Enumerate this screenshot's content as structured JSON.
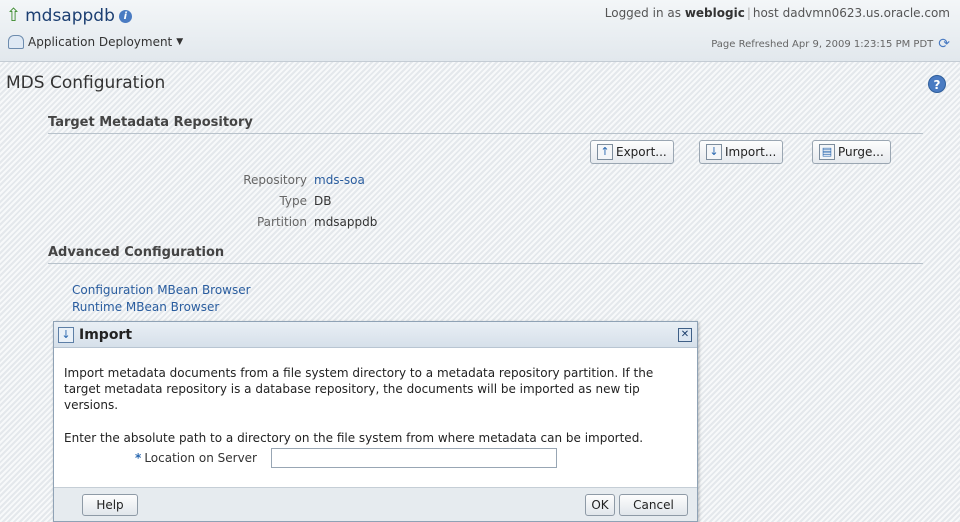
{
  "header": {
    "app_title": "mdsappdb",
    "app_menu": "Application Deployment",
    "login_prefix": "Logged in as",
    "user": "weblogic",
    "host_label": "host",
    "host": "dadvmn0623.us.oracle.com",
    "refreshed": "Page Refreshed Apr 9, 2009 1:23:15 PM PDT"
  },
  "page": {
    "title": "MDS Configuration",
    "help_icon": "?"
  },
  "target_section": {
    "heading": "Target Metadata Repository",
    "buttons": {
      "export": "Export...",
      "import": "Import...",
      "purge": "Purge..."
    },
    "properties": [
      {
        "label": "Repository",
        "value": "mds-soa"
      },
      {
        "label": "Type",
        "value": "DB"
      },
      {
        "label": "Partition",
        "value": "mdsappdb"
      }
    ]
  },
  "advanced_section": {
    "heading": "Advanced Configuration",
    "links": [
      "Configuration MBean Browser",
      "Runtime MBean Browser"
    ]
  },
  "dialog": {
    "title": "Import",
    "description": "Import metadata documents from a file system directory to a metadata repository partition. If the target metadata repository is a database repository, the documents will be imported as new tip versions.",
    "instruction": "Enter the absolute path to a directory on the file system from where metadata can be imported.",
    "location_label": "Location on Server",
    "location_value": "",
    "help_label": "Help",
    "ok_label": "OK",
    "cancel_label": "Cancel"
  },
  "icons": {
    "up": "up-arrow-icon",
    "info": "info-icon",
    "refresh": "refresh-icon",
    "help": "help-icon",
    "close": "close-icon"
  },
  "colors": {
    "link": "#2a5d9f",
    "title": "#1c3f72",
    "accent": "#4a7bc2"
  }
}
